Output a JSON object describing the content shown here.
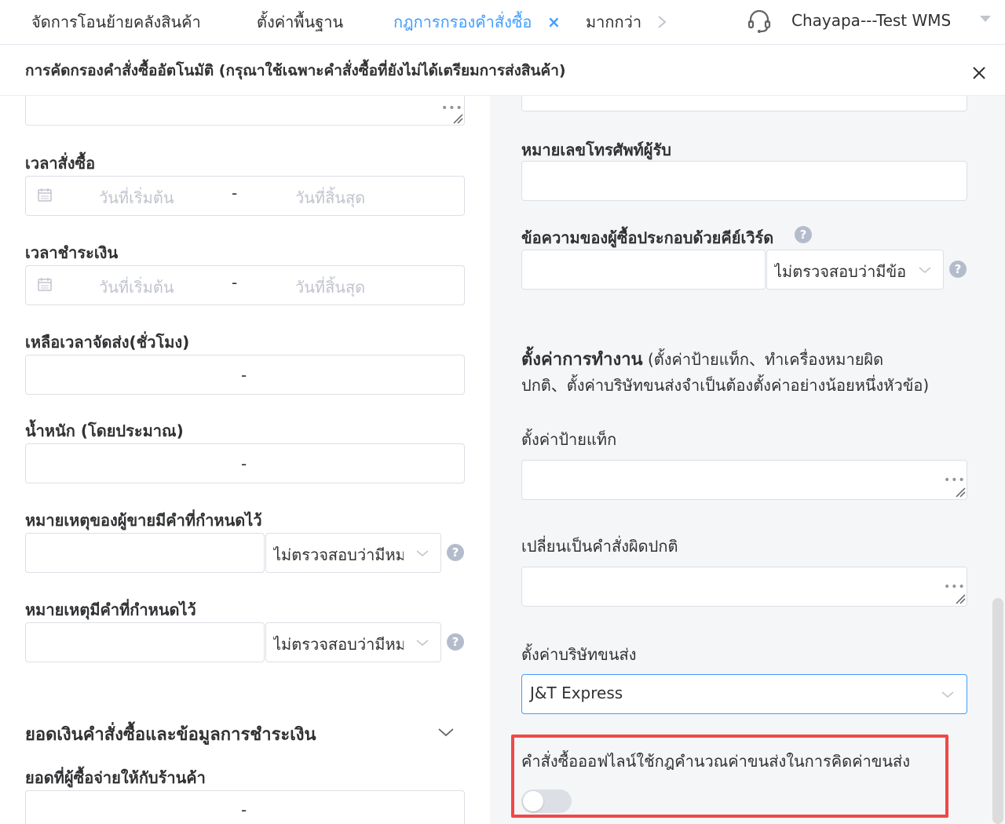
{
  "nav": {
    "tabs": [
      {
        "label": "จัดการโอนย้ายคลังสินค้า"
      },
      {
        "label": "ตั้งค่าพื้นฐาน"
      },
      {
        "label": "กฎการกรองคำสั่งซื้อ"
      },
      {
        "label": "มากกว่า"
      }
    ],
    "close_glyph": "×",
    "user": "Chayapa---Test WMS",
    "icons": {
      "support": "headset-icon",
      "more": "chevron-right-icon",
      "user_menu": "caret-down-icon"
    }
  },
  "dialog": {
    "title": "การคัดกรองคำสั่งซื้ออัตโนมัติ (กรุณาใช้เฉพาะคำสั่งซื้อที่ยังไม่ได้เตรียมการส่งสินค้า)",
    "close_icon": "close-icon"
  },
  "left": {
    "order_time": {
      "label": "เวลาสั่งซื้อ",
      "start": "วันที่เริ่มต้น",
      "end": "วันที่สิ้นสุด",
      "sep": "-"
    },
    "pay_time": {
      "label": "เวลาชำระเงิน",
      "start": "วันที่เริ่มต้น",
      "end": "วันที่สิ้นสุด",
      "sep": "-"
    },
    "remaining_time": {
      "label": "เหลือเวลาจัดส่ง(ชั่วโมง)",
      "sep": "-"
    },
    "weight": {
      "label": "น้ำหนัก (โดยประมาณ)",
      "sep": "-"
    },
    "seller_note": {
      "label": "หมายเหตุของผู้ขายมีคำที่กำหนดไว้",
      "select": "ไม่ตรวจสอบว่ามีหมายเหตุ",
      "help": "?"
    },
    "note": {
      "label": "หมายเหตุมีคำที่กำหนดไว้",
      "select": "ไม่ตรวจสอบว่ามีหมายเหตุ",
      "help": "?"
    },
    "section": {
      "label": "ยอดเงินคำสั่งซื้อและข้อมูลการชำระเงิน"
    },
    "buyer_paid": {
      "label": "ยอดที่ผู้ซื้อจ่ายให้กับร้านค้า",
      "sep": "-"
    },
    "dots": "•••"
  },
  "right": {
    "phone": {
      "label": "หมายเลขโทรศัพท์ผู้รับ"
    },
    "buyer_msg": {
      "label": "ข้อความของผู้ซื้อประกอบด้วยคีย์เวิร์ด",
      "select": "ไม่ตรวจสอบว่ามีข้อความ",
      "help": "?"
    },
    "ops": {
      "title": "ตั้งค่าการทำงาน",
      "line1": "(ตั้งค่าป้ายแท็ก、ทำเครื่องหมายผิด",
      "line2": "ปกติ、ตั้งค่าบริษัทขนส่งจำเป็นต้องตั้งค่าอย่างน้อยหนึ่งหัวข้อ)"
    },
    "tag": {
      "label": "ตั้งค่าป้ายแท็ก"
    },
    "abnormal": {
      "label": "เปลี่ยนเป็นคำสั่งผิดปกติ"
    },
    "carrier": {
      "label": "ตั้งค่าบริษัทขนส่ง",
      "value": "J&T Express"
    },
    "offline_rule": {
      "label": "คำสั่งซื้อออฟไลน์ใช้กฎคำนวณค่าขนส่งในการคิดค่าขนส่ง",
      "enabled": false
    },
    "dots": "•••"
  }
}
